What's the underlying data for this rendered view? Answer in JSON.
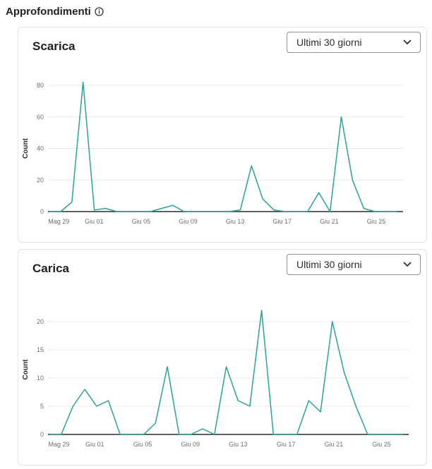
{
  "header": {
    "title": "Approfondimenti",
    "info_icon": "info-icon"
  },
  "period_options": [
    "Ultimi 30 giorni"
  ],
  "colors": {
    "line": "#2aa19a",
    "baseline": "#2c2c2c",
    "grid": "#e8e8e8"
  },
  "chart_data": [
    {
      "type": "line",
      "title": "Scarica",
      "dropdown_value": "Ultimi 30 giorni",
      "ylabel": "Count",
      "ylim": [
        0,
        80
      ],
      "yticks": [
        0,
        20,
        40,
        60,
        80
      ],
      "xtick_labels": [
        "Mag 29",
        "Giu 01",
        "Giu 05",
        "Giu 09",
        "Giu 13",
        "Giu 17",
        "Giu 21",
        "Giu 25"
      ],
      "xtick_index": [
        0,
        3,
        7,
        11,
        15,
        19,
        23,
        27
      ],
      "x": [
        "Mag 28",
        "Mag 29",
        "Mag 30",
        "Mag 31",
        "Giu 01",
        "Giu 02",
        "Giu 03",
        "Giu 04",
        "Giu 05",
        "Giu 06",
        "Giu 07",
        "Giu 08",
        "Giu 09",
        "Giu 10",
        "Giu 11",
        "Giu 12",
        "Giu 13",
        "Giu 14",
        "Giu 15",
        "Giu 16",
        "Giu 17",
        "Giu 18",
        "Giu 19",
        "Giu 20",
        "Giu 21",
        "Giu 22",
        "Giu 23",
        "Giu 24",
        "Giu 25",
        "Giu 26"
      ],
      "series": [
        {
          "values": [
            0,
            0,
            6,
            82,
            1,
            2,
            0,
            0,
            0,
            0,
            2,
            4,
            0,
            0,
            0,
            0,
            0,
            1,
            29,
            8,
            1,
            0,
            0,
            0,
            12,
            0,
            60,
            20,
            2,
            0,
            0,
            0
          ]
        }
      ]
    },
    {
      "type": "line",
      "title": "Carica",
      "dropdown_value": "Ultimi 30 giorni",
      "ylabel": "Count",
      "ylim": [
        0,
        23
      ],
      "yticks": [
        0,
        5,
        10,
        15,
        20
      ],
      "xtick_labels": [
        "Mag 29",
        "Giu 01",
        "Giu 05",
        "Giu 09",
        "Giu 13",
        "Giu 17",
        "Giu 21",
        "Giu 25"
      ],
      "xtick_index": [
        0,
        3,
        7,
        11,
        15,
        19,
        23,
        27
      ],
      "series": [
        {
          "values": [
            0,
            0,
            5,
            8,
            5,
            6,
            0,
            0,
            0,
            2,
            12,
            0,
            0,
            1,
            0,
            12,
            6,
            5,
            22,
            0,
            0,
            0,
            6,
            4,
            20,
            11,
            5,
            0,
            0,
            0,
            0
          ]
        }
      ]
    }
  ]
}
